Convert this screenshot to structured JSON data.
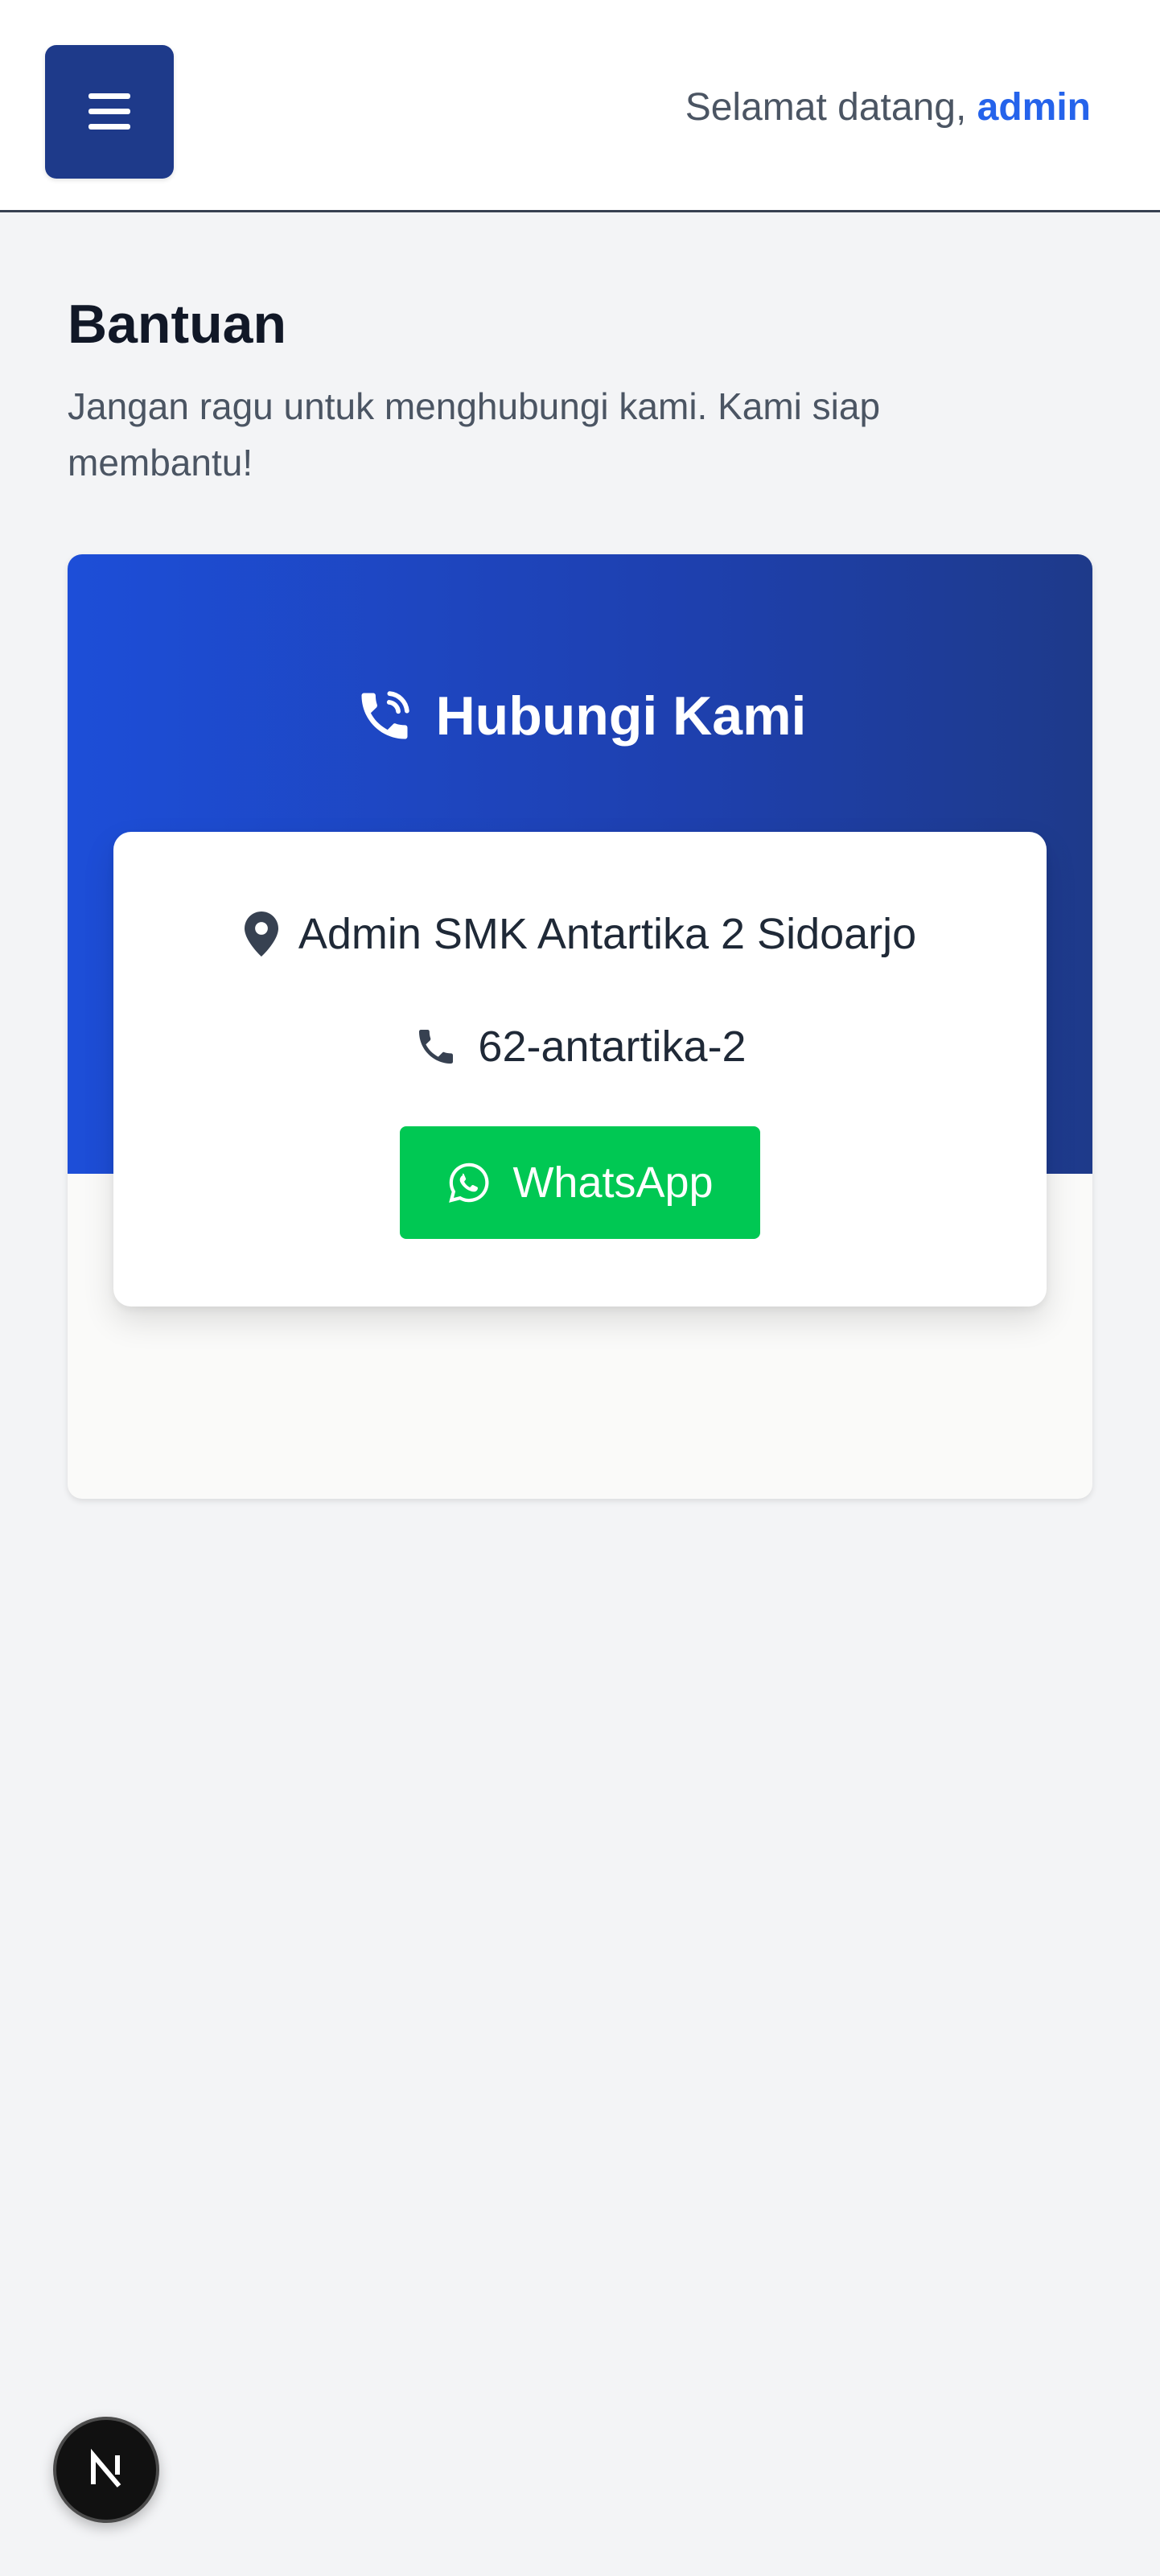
{
  "header": {
    "welcome_prefix": "Selamat datang,",
    "username": "admin"
  },
  "page": {
    "title": "Bantuan",
    "subtitle": "Jangan ragu untuk menghubungi kami. Kami siap membantu!"
  },
  "contact": {
    "title": "Hubungi Kami",
    "address": "Admin SMK Antartika 2 Sidoarjo",
    "phone": "62-antartika-2",
    "whatsapp_label": "WhatsApp"
  },
  "colors": {
    "primary": "#1e3a8a",
    "accent": "#2563eb",
    "whatsapp": "#00c853"
  },
  "icons": [
    "menu-icon",
    "phone-call-icon",
    "map-pin-icon",
    "phone-icon",
    "whatsapp-icon",
    "nextjs-logo-icon"
  ]
}
